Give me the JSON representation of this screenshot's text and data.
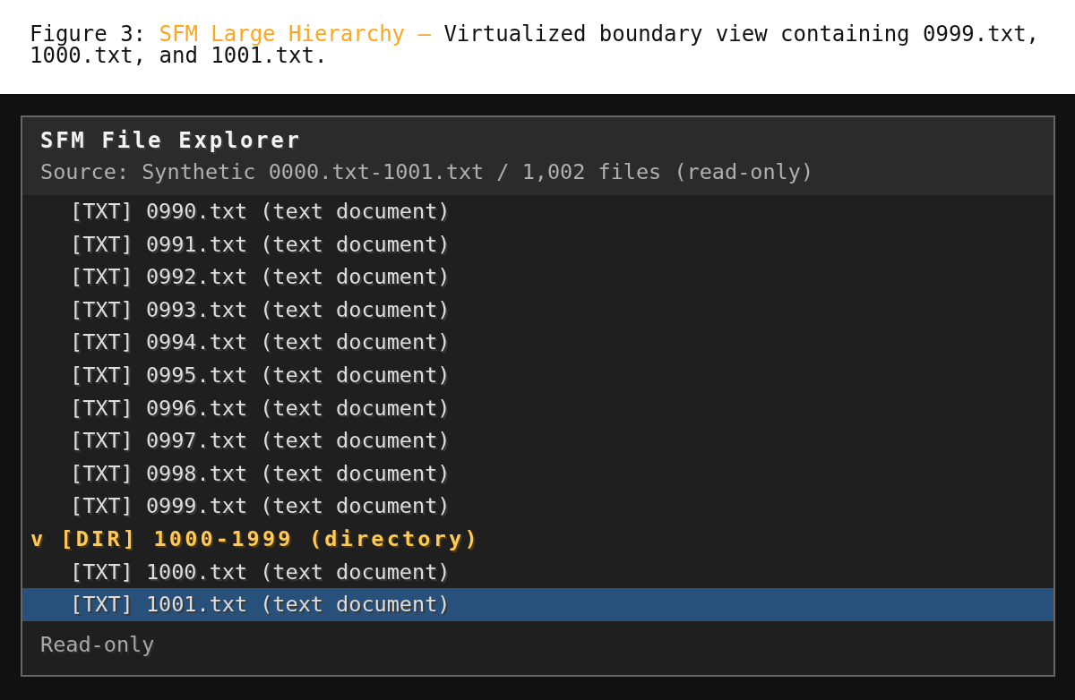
{
  "caption": {
    "label": "Figure 3:",
    "title": "SFM Large Hierarchy —",
    "text": "Virtualized boundary view containing 0999.txt, 1000.txt, and 1001.txt."
  },
  "window": {
    "title": "SFM File Explorer",
    "subtitle": "Source: Synthetic 0000.txt-1001.txt / 1,002 files (read-only)"
  },
  "tree": [
    {
      "kind": "group",
      "children": [
        {
          "kind": "file",
          "label": "[TXT] 0990.txt (text document)",
          "selected": false
        },
        {
          "kind": "file",
          "label": "[TXT] 0991.txt (text document)",
          "selected": false
        },
        {
          "kind": "file",
          "label": "[TXT] 0992.txt (text document)",
          "selected": false
        },
        {
          "kind": "file",
          "label": "[TXT] 0993.txt (text document)",
          "selected": false
        },
        {
          "kind": "file",
          "label": "[TXT] 0994.txt (text document)",
          "selected": false
        },
        {
          "kind": "file",
          "label": "[TXT] 0995.txt (text document)",
          "selected": false
        },
        {
          "kind": "file",
          "label": "[TXT] 0996.txt (text document)",
          "selected": false
        },
        {
          "kind": "file",
          "label": "[TXT] 0997.txt (text document)",
          "selected": false
        },
        {
          "kind": "file",
          "label": "[TXT] 0998.txt (text document)",
          "selected": false
        },
        {
          "kind": "file",
          "label": "[TXT] 0999.txt (text document)",
          "selected": false
        }
      ]
    },
    {
      "kind": "dir",
      "toggle": "v",
      "label": "[DIR] 1000-1999 (directory)",
      "expanded": true,
      "selected": false,
      "children": [
        {
          "kind": "file",
          "label": "[TXT] 1000.txt (text document)",
          "selected": false
        },
        {
          "kind": "file",
          "label": "[TXT] 1001.txt (text document)",
          "selected": true
        }
      ]
    }
  ],
  "status_bar": {
    "text": "Read-only"
  }
}
